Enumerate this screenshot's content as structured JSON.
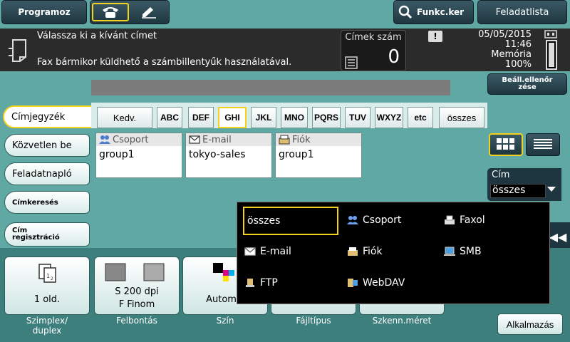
{
  "topbar": {
    "program_label": "Programoz",
    "search_label": "Funkc.ker",
    "joblist_label": "Feladatlista"
  },
  "message": {
    "line1": "Válassza ki a kívánt címet",
    "line2": "Fax bármikor küldhető a számbillentyűk használatával."
  },
  "status": {
    "addr_count_label": "Címek szám",
    "addr_count_value": "0",
    "date": "05/05/2015",
    "time": "11:46",
    "memory_label": "Memória",
    "memory_value": "100%",
    "memory_level": 1.0
  },
  "check_settings_label": "Beáll.ellenőr\nzése",
  "sidebar": {
    "items": [
      {
        "label": "Címjegyzék"
      },
      {
        "label": "Közvetlen be"
      },
      {
        "label": "Feladatnapló"
      },
      {
        "label": "Címkeresés"
      },
      {
        "label": "Cím\nregisztráció"
      }
    ]
  },
  "index_tabs": [
    "Kedv.",
    "ABC",
    "DEF",
    "GHI",
    "JKL",
    "MNO",
    "PQRS",
    "TUV",
    "WXYZ",
    "etc",
    "összes"
  ],
  "address_cards": [
    {
      "type": "Csoport",
      "value": "group1",
      "icon": "group-icon"
    },
    {
      "type": "E-mail",
      "value": "tokyo-sales",
      "icon": "email-icon"
    },
    {
      "type": "Fiók",
      "value": "group1",
      "icon": "box-icon"
    }
  ],
  "type_filter": {
    "label": "Cím",
    "selected": "összes"
  },
  "popup_options": [
    {
      "label": "összes",
      "icon": ""
    },
    {
      "label": "Csoport",
      "icon": "group-icon"
    },
    {
      "label": "Faxol",
      "icon": "fax-icon"
    },
    {
      "label": "E-mail",
      "icon": "email-icon"
    },
    {
      "label": "Fiók",
      "icon": "box-icon"
    },
    {
      "label": "SMB",
      "icon": "pc-icon"
    },
    {
      "label": "FTP",
      "icon": "ftp-icon"
    },
    {
      "label": "WebDAV",
      "icon": "webdav-icon"
    }
  ],
  "settings": [
    {
      "value": "1 old.",
      "label": "Szimplex/\nduplex"
    },
    {
      "value": "S 200 dpi\nF Finom",
      "label": "Felbontás"
    },
    {
      "value": "Autom.s",
      "label": "Szín"
    },
    {
      "value": "",
      "label": "Fájltípus"
    },
    {
      "value": "",
      "label": "Szkenn.méret"
    }
  ],
  "apply_label": "Alkalmazás",
  "colors": {
    "background": "#5fa8a4",
    "dark_button": "#1e3640",
    "highlight": "#f2d21c"
  }
}
